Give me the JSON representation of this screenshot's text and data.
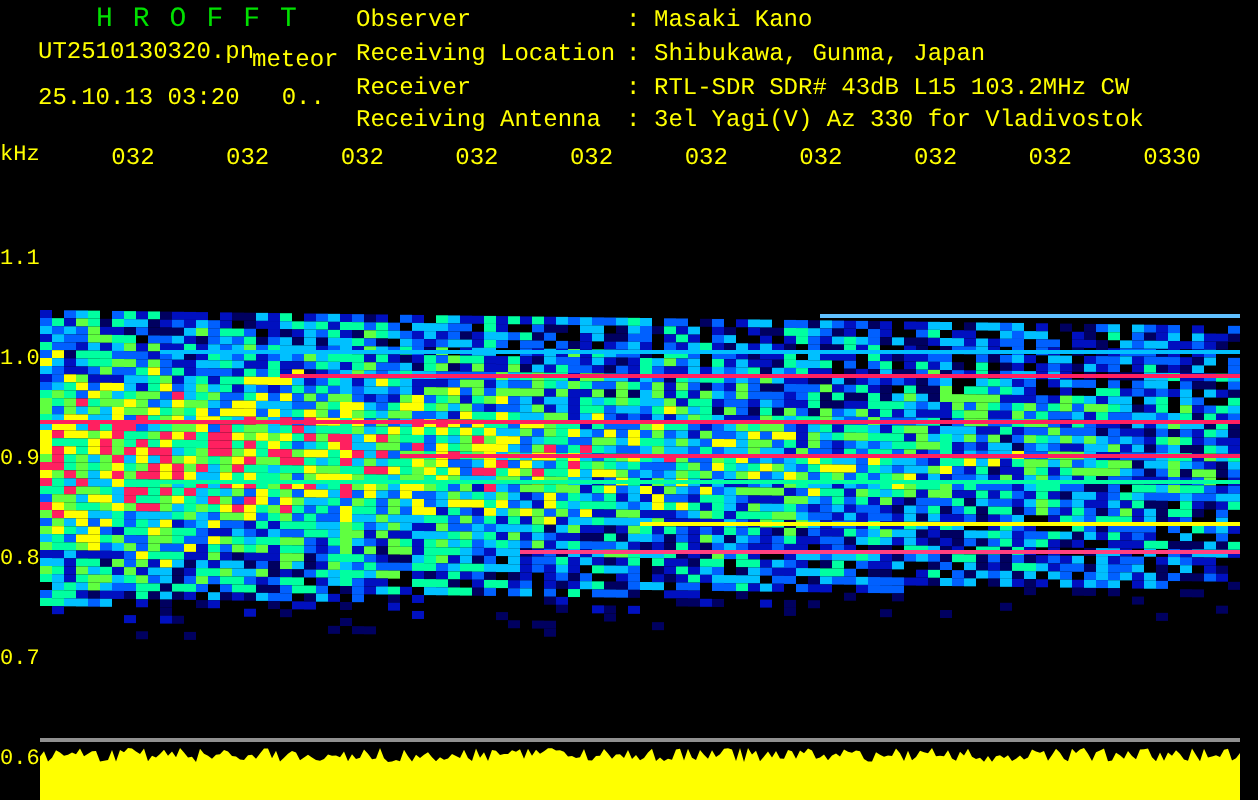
{
  "app": {
    "title": "HROFFT"
  },
  "file": {
    "name": "UT2510130320.pn",
    "mode": "meteor",
    "timestamp": "25.10.13 03:20",
    "value": "0.."
  },
  "station": [
    {
      "label": "Observer",
      "separator": ":",
      "value": "Masaki Kano"
    },
    {
      "label": "Receiving Location",
      "separator": ":",
      "value": "Shibukawa, Gunma, Japan"
    },
    {
      "label": "Receiver",
      "separator": ":",
      "value": "RTL-SDR SDR# 43dB L15 103.2MHz CW"
    },
    {
      "label": "Receiving Antenna",
      "separator": ":",
      "value": "3el Yagi(V) Az 330 for Vladivostok"
    }
  ],
  "frequency_axis": {
    "unit": "kHz",
    "labels": [
      "1.1",
      "1.0",
      "0.9",
      "0.8",
      "0.7",
      "0.6"
    ]
  },
  "time_axis": {
    "labels": [
      "032",
      "032",
      "032",
      "032",
      "032",
      "032",
      "032",
      "032",
      "032",
      "0330"
    ]
  }
}
